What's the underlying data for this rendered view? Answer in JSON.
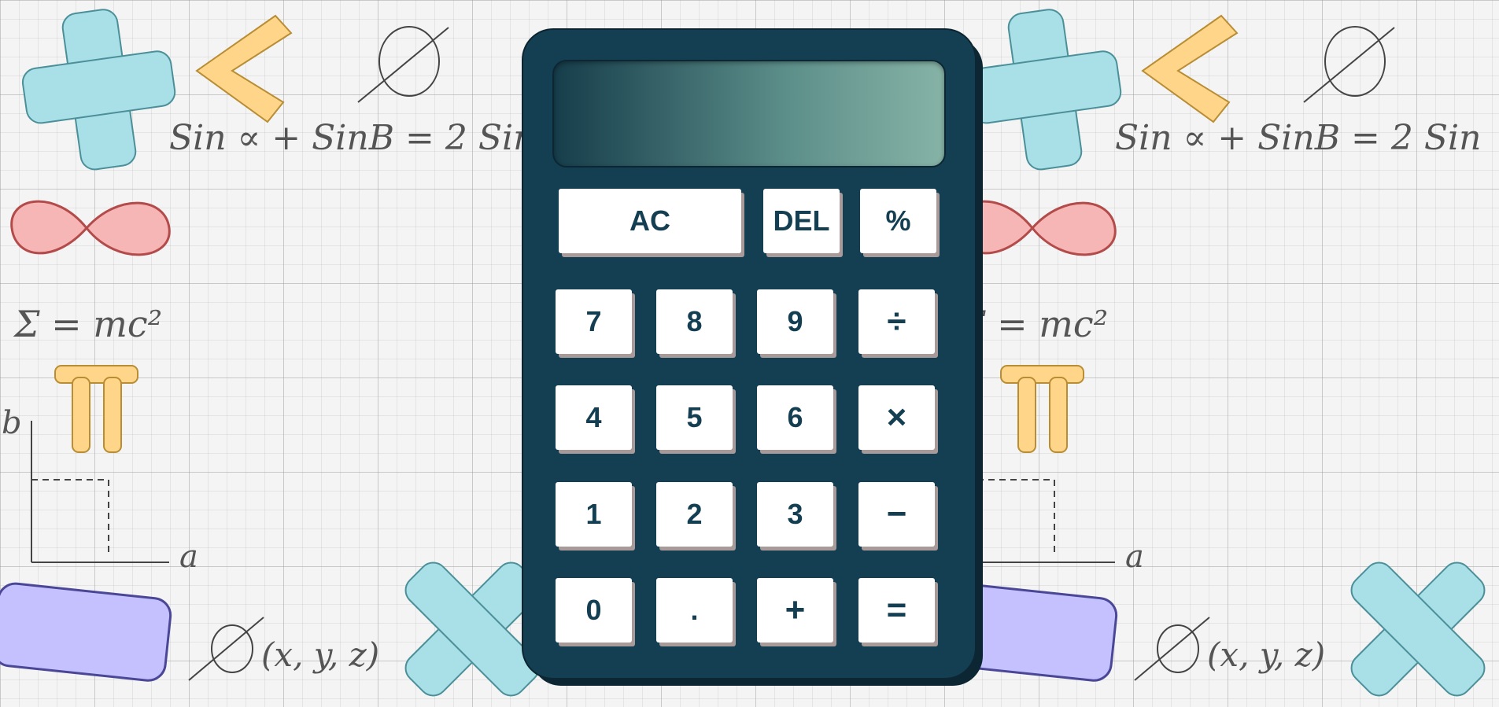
{
  "background": {
    "formulas": [
      "Sin ∝ + SinB = 2 Sin",
      "Σ = mc²",
      "(x, y, z)",
      "b",
      "a"
    ],
    "symbols": [
      "plus-icon",
      "minus-icon",
      "multiply-icon",
      "infinity-icon",
      "pi-icon",
      "empty-set-icon",
      "eraser-icon"
    ]
  },
  "calculator": {
    "display_value": "",
    "keys": {
      "ac": "AC",
      "del": "DEL",
      "percent": "%",
      "seven": "7",
      "eight": "8",
      "nine": "9",
      "divide": "÷",
      "four": "4",
      "five": "5",
      "six": "6",
      "multiply": "×",
      "one": "1",
      "two": "2",
      "three": "3",
      "minus": "−",
      "zero": "0",
      "dot": ".",
      "plus": "+",
      "equals": "="
    }
  },
  "colors": {
    "body": "#143f52",
    "key_face": "#ffffff",
    "key_shadow": "#a79a98",
    "key_text": "#143f52",
    "display_dark": "#163d4b",
    "display_light": "#86b3a6"
  }
}
